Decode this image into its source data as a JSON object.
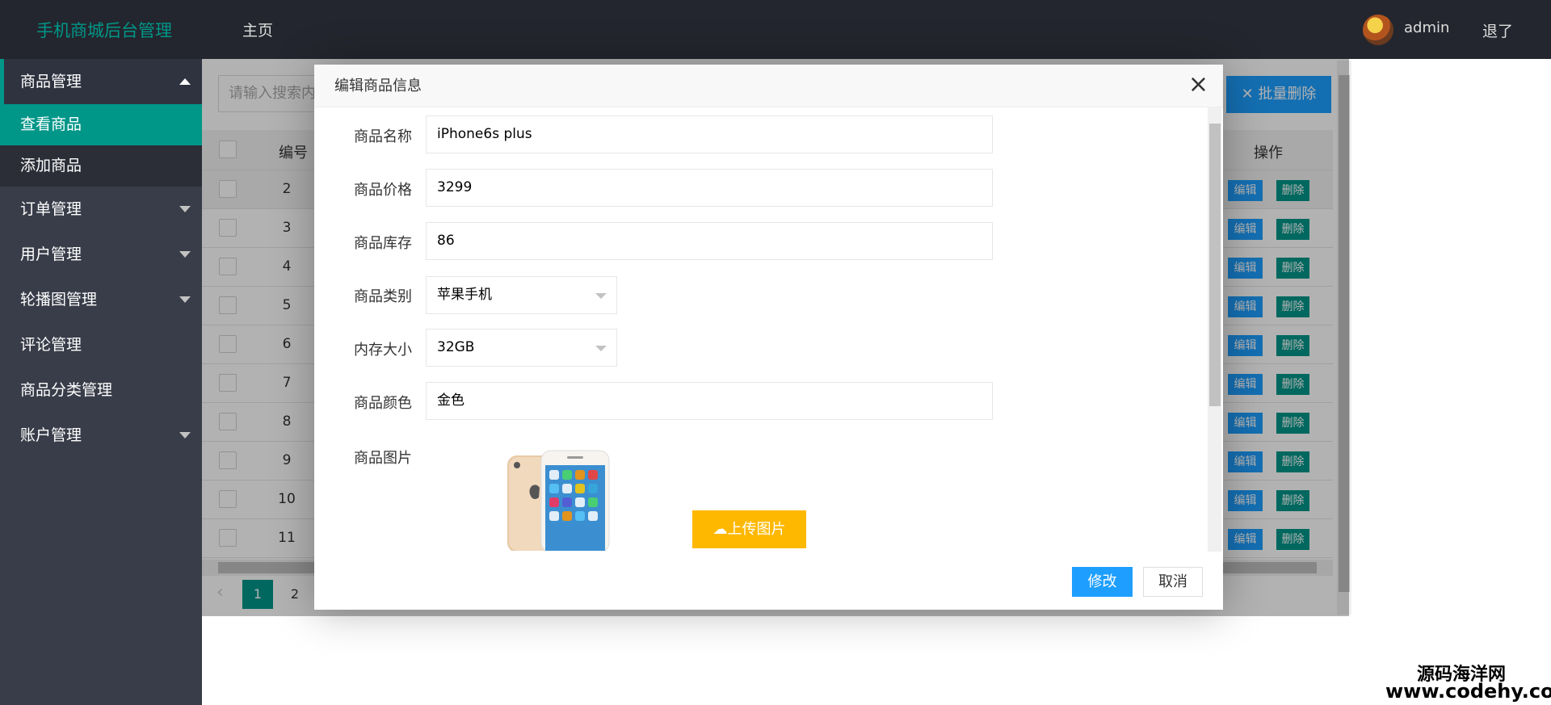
{
  "header": {
    "logo": "手机商城后台管理",
    "home": "主页",
    "user": "admin",
    "logout": "退了"
  },
  "sidebar": {
    "items": [
      {
        "label": "商品管理",
        "children": [
          "查看商品",
          "添加商品"
        ]
      },
      {
        "label": "订单管理"
      },
      {
        "label": "用户管理"
      },
      {
        "label": "轮播图管理"
      },
      {
        "label": "评论管理"
      },
      {
        "label": "商品分类管理"
      },
      {
        "label": "账户管理"
      }
    ]
  },
  "toolbar": {
    "search_placeholder": "请输入搜索内容",
    "batch_delete": "批量删除"
  },
  "table": {
    "headers": {
      "num": "编号",
      "op": "操作"
    },
    "rows": [
      "2",
      "3",
      "4",
      "5",
      "6",
      "7",
      "8",
      "9",
      "10",
      "11"
    ],
    "edit_label": "编辑",
    "delete_label": "删除"
  },
  "pager": {
    "pages": [
      "1",
      "2"
    ],
    "current": "1"
  },
  "modal": {
    "title": "编辑商品信息",
    "close": "×",
    "fields": {
      "name_label": "商品名称",
      "name_value": "iPhone6s plus",
      "price_label": "商品价格",
      "price_value": "3299",
      "stock_label": "商品库存",
      "stock_value": "86",
      "category_label": "商品类别",
      "category_value": "苹果手机",
      "memory_label": "内存大小",
      "memory_value": "32GB",
      "color_label": "商品颜色",
      "color_value": "金色",
      "image_label": "商品图片"
    },
    "upload_label": "上传图片",
    "modify_label": "修改",
    "cancel_label": "取消"
  },
  "watermark": {
    "line1": "源码海洋网",
    "line2": "www.codehy.com"
  },
  "colors": {
    "accent": "#009688",
    "primary": "#1e9fff",
    "warm": "#ffb800",
    "header_bg": "#23262e",
    "sidebar_bg": "#393d49"
  }
}
